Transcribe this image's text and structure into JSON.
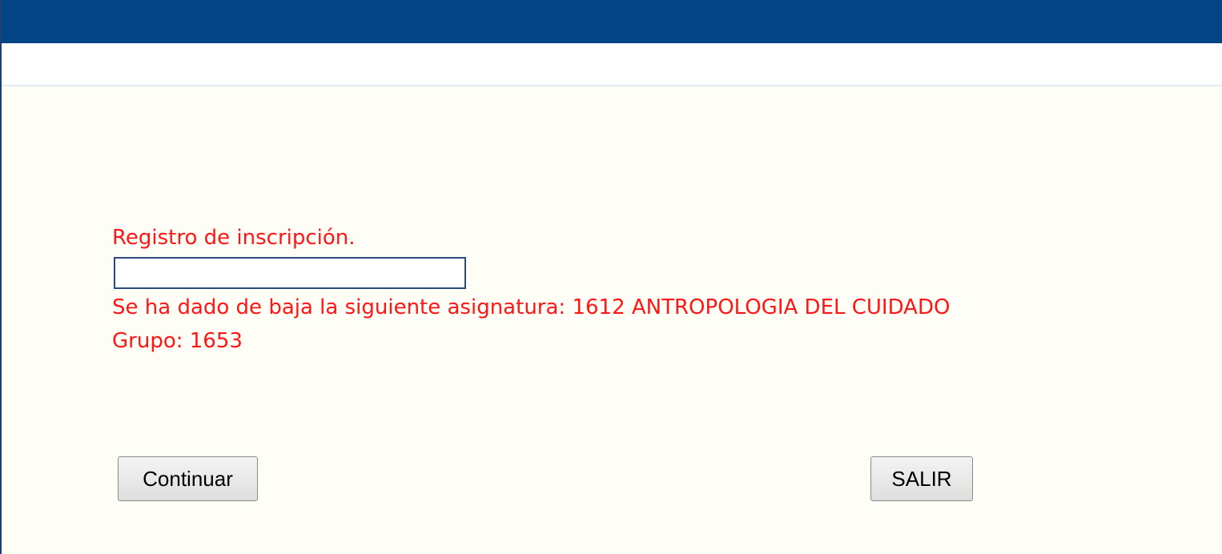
{
  "message": {
    "registration_title": "Registro de inscripción.",
    "registration_input_value": "",
    "drop_notice": "Se ha dado de baja la siguiente asignatura: 1612 ANTROPOLOGIA DEL CUIDADO",
    "group_line": "Grupo: 1653"
  },
  "actions": {
    "continue_label": "Continuar",
    "exit_label": "SALIR"
  },
  "colors": {
    "header": "#034484",
    "background": "#fefef6",
    "message_text": "#ff1616"
  }
}
